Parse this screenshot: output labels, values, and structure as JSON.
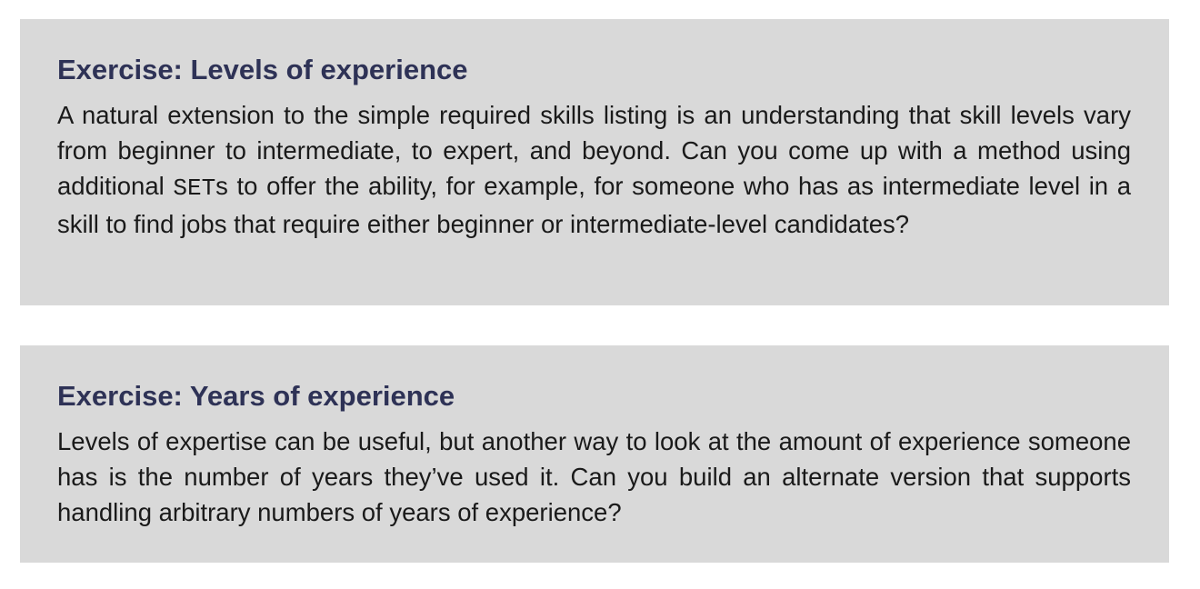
{
  "exercises": [
    {
      "title": "Exercise: Levels of experience",
      "text_before_code": "A natural extension to the simple required skills listing is an understanding that skill levels vary from beginner to intermediate, to expert, and beyond. Can you come up with a method using additional ",
      "code": "SET",
      "text_after_code": "s to offer the ability, for example, for someone who has as intermediate level in a skill to find jobs that require either beginner or intermediate-level candidates?"
    },
    {
      "title": "Exercise: Years of experience",
      "text": "Levels of expertise can be useful, but another way to look at the amount of experi­ence someone has is the number of years they’ve used it. Can you build an alternate version that supports handling arbitrary numbers of years of experience?"
    }
  ]
}
